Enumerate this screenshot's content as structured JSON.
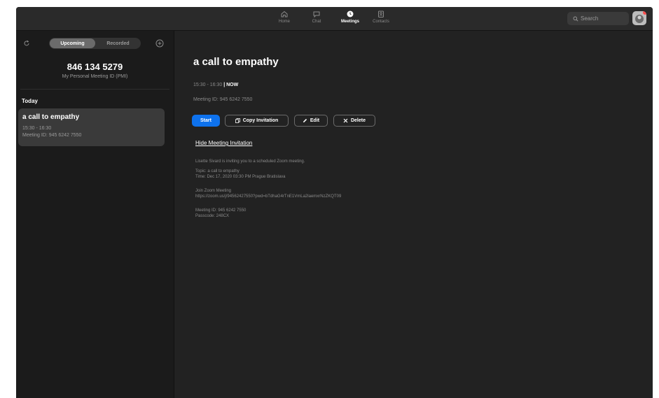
{
  "nav": {
    "items": [
      {
        "label": "Home",
        "icon": "home-icon"
      },
      {
        "label": "Chat",
        "icon": "chat-icon"
      },
      {
        "label": "Meetings",
        "icon": "clock-icon",
        "active": true
      },
      {
        "label": "Contacts",
        "icon": "contacts-icon"
      }
    ],
    "search_label": "Search"
  },
  "sidebar": {
    "tabs": [
      "Upcoming",
      "Recorded"
    ],
    "active_tab": "Upcoming",
    "pmi_number": "846 134 5279",
    "pmi_label": "My Personal Meeting ID (PMI)",
    "day_label": "Today",
    "meeting": {
      "title": "a call to empathy",
      "time": "15:30 - 16:30",
      "meeting_id": "Meeting ID: 945 6242 7550"
    }
  },
  "main": {
    "title": "a call to empathy",
    "time_range": "15:30 - 16:30",
    "now_label": "| NOW",
    "meeting_id": "Meeting ID: 945 6242 7550",
    "buttons": {
      "start": "Start",
      "copy": "Copy Invitation",
      "edit": "Edit",
      "delete": "Delete"
    },
    "hide_link": "Hide Meeting Invitation",
    "invitation": {
      "intro": "Lisette Sivard is inviting you to a scheduled Zoom meeting.",
      "topic": "Topic: a call to empathy",
      "time": "Time: Dec 17, 2020 03:30 PM Prague Bratislava",
      "join_label": "Join Zoom Meeting",
      "join_url": "https://zoom.us/j/94562427550?pwd=bTdhaG4rTnE1VmLa2laemxrNzZKQT09",
      "meeting_id": "Meeting ID: 945 6242 7550",
      "passcode": "Passcode: 248CX"
    }
  },
  "colors": {
    "accent": "#0e72ed",
    "background": "#222222",
    "sidebar": "#1b1b1b",
    "card": "#3a3a3a"
  }
}
